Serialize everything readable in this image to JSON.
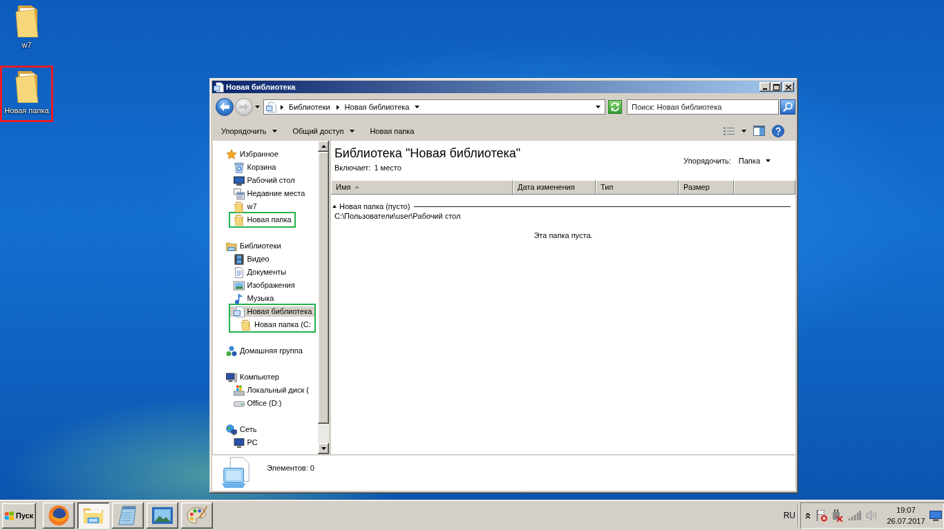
{
  "desktop": {
    "icons": [
      {
        "label": "w7"
      },
      {
        "label": "Новая папка",
        "highlight": {
          "color": "#ed1c24"
        }
      }
    ]
  },
  "window": {
    "title": "Новая библиотека",
    "address": {
      "crumbs": [
        "Библиотеки",
        "Новая библиотека"
      ]
    },
    "search": {
      "placeholder": "Поиск: Новая библиотека"
    },
    "toolbar": [
      {
        "label": "Упорядочить",
        "menu": true
      },
      {
        "label": "Общий доступ",
        "menu": true
      },
      {
        "label": "Новая папка",
        "menu": false
      }
    ],
    "nav": [
      {
        "label": "Избранное",
        "kind": "star",
        "selected": false,
        "children": [
          {
            "label": "Корзина",
            "kind": "recycle-bin",
            "selected": false
          },
          {
            "label": "Рабочий стол",
            "kind": "desktop",
            "selected": false
          },
          {
            "label": "Недавние места",
            "kind": "recent",
            "selected": false
          },
          {
            "label": "w7",
            "kind": "folder",
            "selected": false
          },
          {
            "label": "Новая папка",
            "kind": "folder",
            "selected": false,
            "highlight": {
              "color": "#22b14c"
            }
          }
        ]
      },
      {
        "label": "Библиотеки",
        "kind": "library-group",
        "selected": false,
        "children": [
          {
            "label": "Видео",
            "kind": "video",
            "selected": false
          },
          {
            "label": "Документы",
            "kind": "documents",
            "selected": false
          },
          {
            "label": "Изображения",
            "kind": "images",
            "selected": false
          },
          {
            "label": "Музыка",
            "kind": "music",
            "selected": false
          },
          {
            "label": "Новая библиотека",
            "kind": "library",
            "selected": true,
            "highlight": {
              "color": "#22b14c"
            },
            "children": [
              {
                "label": "Новая папка (C:",
                "kind": "folder",
                "selected": false
              }
            ]
          }
        ]
      },
      {
        "label": "Домашняя группа",
        "kind": "homegroup",
        "selected": false
      },
      {
        "label": "Компьютер",
        "kind": "computer",
        "selected": false,
        "children": [
          {
            "label": "Локальный диск (",
            "kind": "local-disk",
            "selected": false
          },
          {
            "label": "Office (D:)",
            "kind": "drive",
            "selected": false
          }
        ]
      },
      {
        "label": "Сеть",
        "kind": "network",
        "selected": false,
        "children": [
          {
            "label": "PC",
            "kind": "pc",
            "selected": false
          }
        ]
      }
    ],
    "content": {
      "title": "Библиотека \"Новая библиотека\"",
      "includes_label": "Включает:",
      "includes_link": "1 место",
      "arrange_label": "Упорядочить:",
      "arrange_value": "Папка",
      "columns": [
        {
          "label": "Имя",
          "sorted": true
        },
        {
          "label": "Дата изменения",
          "sorted": false
        },
        {
          "label": "Тип",
          "sorted": false
        },
        {
          "label": "Размер",
          "sorted": false
        }
      ],
      "groups": [
        {
          "title": "Новая папка (пусто)",
          "path": "C:\\Пользователи\\user\\Рабочий стол",
          "expanded": true
        }
      ],
      "empty_message": "Эта папка пуста."
    },
    "details": {
      "count": "Элементов: 0"
    }
  },
  "taskbar": {
    "start": "Пуск",
    "apps": [
      {
        "kind": "browser",
        "selected": false
      },
      {
        "kind": "explorer",
        "selected": true
      },
      {
        "kind": "notepad",
        "selected": false
      },
      {
        "kind": "picture-viewer",
        "selected": false
      },
      {
        "kind": "paint",
        "selected": false
      }
    ],
    "language": "RU",
    "time": "19:07",
    "date": "26.07.2017"
  }
}
